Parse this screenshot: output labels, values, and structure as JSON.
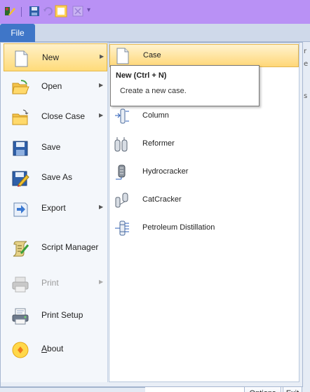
{
  "quick_access": {
    "icons": [
      "app-logo-icon",
      "save-icon",
      "undo-icon",
      "new-document-icon",
      "close-document-icon",
      "customize-dropdown-icon"
    ],
    "more_glyph": "▾"
  },
  "ribbon": {
    "file_tab": "File"
  },
  "left_menu": {
    "items": [
      {
        "label": "New",
        "icon": "new-document-icon",
        "has_submenu": true,
        "active": true,
        "enabled": true
      },
      {
        "label": "Open",
        "icon": "open-folder-icon",
        "has_submenu": true,
        "active": false,
        "enabled": true
      },
      {
        "label": "Close Case",
        "icon": "close-case-folder-icon",
        "has_submenu": true,
        "active": false,
        "enabled": true
      },
      {
        "label": "Save",
        "icon": "save-icon",
        "has_submenu": false,
        "active": false,
        "enabled": true
      },
      {
        "label": "Save As",
        "icon": "save-as-icon",
        "has_submenu": false,
        "active": false,
        "enabled": true
      },
      {
        "label": "Export",
        "icon": "export-icon",
        "has_submenu": true,
        "active": false,
        "enabled": true
      },
      {
        "label": "Script Manager",
        "icon": "script-manager-icon",
        "has_submenu": false,
        "active": false,
        "enabled": true
      },
      {
        "label": "Print",
        "icon": "printer-icon",
        "has_submenu": true,
        "active": false,
        "enabled": false
      },
      {
        "label": "Print Setup",
        "icon": "print-setup-icon",
        "has_submenu": false,
        "active": false,
        "enabled": true
      },
      {
        "label_first": "A",
        "label_rest": "bout",
        "icon": "about-icon",
        "has_submenu": false,
        "active": false,
        "enabled": true
      }
    ],
    "arrow_glyph": "▶"
  },
  "submenu": {
    "items": [
      {
        "label": "Case",
        "icon": "case-document-icon",
        "active": true
      },
      {
        "label": "Column",
        "icon": "column-icon",
        "active": false
      },
      {
        "label": "Reformer",
        "icon": "reformer-icon",
        "active": false
      },
      {
        "label": "Hydrocracker",
        "icon": "hydrocracker-icon",
        "active": false
      },
      {
        "label": "CatCracker",
        "icon": "catcracker-icon",
        "active": false
      },
      {
        "label": "Petroleum Distillation",
        "icon": "petroleum-distillation-icon",
        "active": false
      }
    ]
  },
  "tooltip": {
    "title": "New (Ctrl + N)",
    "body": "Create a new case."
  },
  "footer": {
    "options_label": "Options",
    "exit_first": "E",
    "exit_rest": "xit"
  },
  "background_fragments": [
    "r",
    "e",
    "s"
  ],
  "colors": {
    "title_bar": "#b991f5",
    "file_tab": "#3f76c8",
    "active_highlight": "#ffdb7a"
  }
}
